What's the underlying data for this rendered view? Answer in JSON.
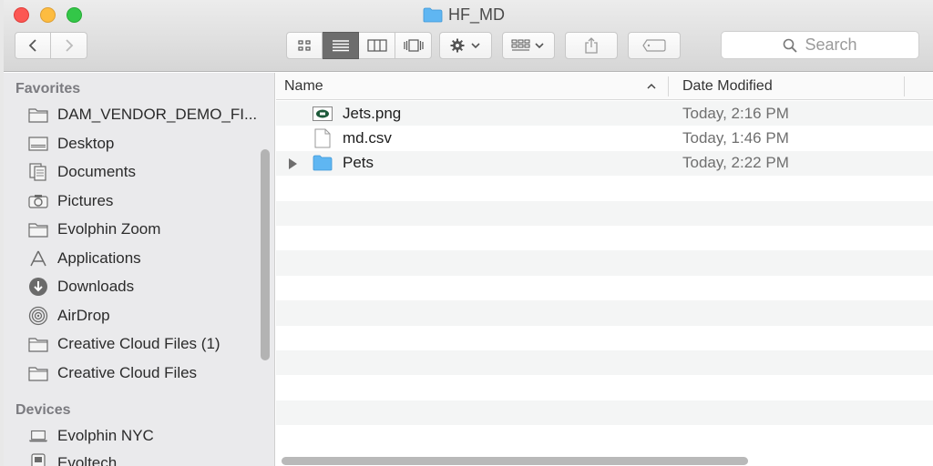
{
  "window": {
    "title": "HF_MD"
  },
  "toolbar": {
    "search_placeholder": "Search",
    "active_view": "list"
  },
  "sidebar": {
    "sections": [
      {
        "heading": "Favorites",
        "items": [
          {
            "label": "DAM_VENDOR_DEMO_FI...",
            "icon": "folder-icon"
          },
          {
            "label": "Desktop",
            "icon": "desktop-icon"
          },
          {
            "label": "Documents",
            "icon": "documents-icon"
          },
          {
            "label": "Pictures",
            "icon": "camera-icon"
          },
          {
            "label": "Evolphin Zoom",
            "icon": "folder-icon"
          },
          {
            "label": "Applications",
            "icon": "applications-icon"
          },
          {
            "label": "Downloads",
            "icon": "downloads-icon"
          },
          {
            "label": "AirDrop",
            "icon": "airdrop-icon"
          },
          {
            "label": "Creative Cloud Files (1)",
            "icon": "folder-icon"
          },
          {
            "label": "Creative Cloud Files",
            "icon": "folder-icon"
          }
        ]
      },
      {
        "heading": "Devices",
        "items": [
          {
            "label": "Evolphin NYC",
            "icon": "laptop-icon"
          },
          {
            "label": "Evoltech",
            "icon": "hard-drive-icon"
          }
        ]
      }
    ]
  },
  "columns": {
    "name": "Name",
    "date": "Date Modified"
  },
  "files": [
    {
      "name": "Jets.png",
      "date": "Today, 2:16 PM",
      "icon": "image-file-icon"
    },
    {
      "name": "md.csv",
      "date": "Today, 1:46 PM",
      "icon": "document-file-icon"
    },
    {
      "name": "Pets",
      "date": "Today, 2:22 PM",
      "icon": "folder-icon"
    }
  ],
  "colors": {
    "folder_blue": "#5fb6f2",
    "sidebar_bg": "#eaeaec",
    "stripe": "#f4f5f5"
  }
}
